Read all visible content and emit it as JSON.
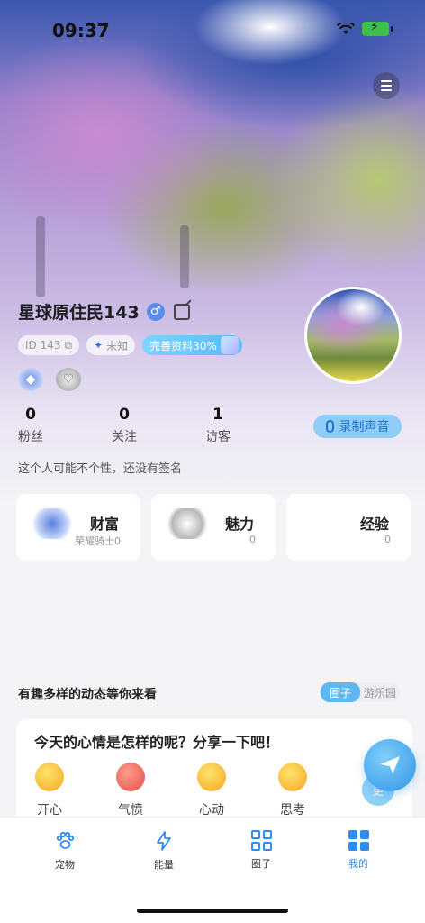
{
  "status_bar": {
    "time": "09:37"
  },
  "profile": {
    "name": "星球原住民143",
    "id_tag": "ID 143",
    "zodiac_tag": "未知",
    "complete_tag": "完善资料30%"
  },
  "stats": [
    {
      "value": "0",
      "label": "粉丝"
    },
    {
      "value": "0",
      "label": "关注"
    },
    {
      "value": "1",
      "label": "访客"
    }
  ],
  "record_button": "录制声音",
  "signature": "这个人可能不个性，还没有签名",
  "cards": [
    {
      "title": "财富",
      "subtitle": "荣耀骑士0"
    },
    {
      "title": "魅力",
      "subtitle": "0"
    },
    {
      "title": "经验",
      "subtitle": "0"
    }
  ],
  "feed": {
    "title": "有趣多样的动态等你来看",
    "tabs": [
      "圈子",
      "游乐园"
    ]
  },
  "mood": {
    "title": "今天的心情是怎样的呢？分享一下吧！",
    "items": [
      {
        "label": "开心"
      },
      {
        "label": "气愤"
      },
      {
        "label": "心动"
      },
      {
        "label": "思考"
      }
    ],
    "more": "更"
  },
  "tabbar": [
    {
      "label": "宠物",
      "icon": "paw-icon"
    },
    {
      "label": "能量",
      "icon": "lightning-icon"
    },
    {
      "label": "圈子",
      "icon": "grid-icon"
    },
    {
      "label": "我的",
      "icon": "apps-icon"
    }
  ],
  "colors": {
    "accent": "#2f8cf0",
    "background": "#f4f4f6"
  }
}
